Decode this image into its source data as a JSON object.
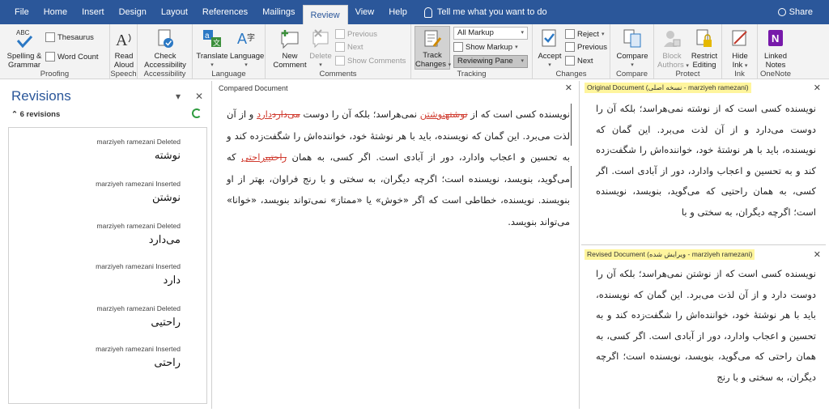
{
  "tabs": {
    "file": "File",
    "home": "Home",
    "insert": "Insert",
    "design": "Design",
    "layout": "Layout",
    "references": "References",
    "mailings": "Mailings",
    "review": "Review",
    "view": "View",
    "help": "Help",
    "tell_me": "Tell me what you want to do",
    "share": "Share"
  },
  "ribbon": {
    "proofing": {
      "label": "Proofing",
      "spelling_1": "Spelling &",
      "spelling_2": "Grammar",
      "thesaurus": "Thesaurus",
      "word_count": "Word Count"
    },
    "speech": {
      "label": "Speech",
      "read_1": "Read",
      "read_2": "Aloud"
    },
    "accessibility": {
      "label": "Accessibility",
      "check_1": "Check",
      "check_2": "Accessibility"
    },
    "language": {
      "label": "Language",
      "translate": "Translate",
      "language": "Language"
    },
    "comments": {
      "label": "Comments",
      "new_1": "New",
      "new_2": "Comment",
      "delete": "Delete",
      "previous": "Previous",
      "next": "Next",
      "show_comments": "Show Comments"
    },
    "tracking": {
      "label": "Tracking",
      "track_1": "Track",
      "track_2": "Changes",
      "all_markup": "All Markup",
      "show_markup": "Show Markup",
      "reviewing_pane": "Reviewing Pane"
    },
    "changes": {
      "label": "Changes",
      "accept": "Accept",
      "reject": "Reject",
      "previous": "Previous",
      "next": "Next"
    },
    "compare": {
      "label": "Compare",
      "compare": "Compare"
    },
    "protect": {
      "label": "Protect",
      "block_1": "Block",
      "block_2": "Authors",
      "restrict_1": "Restrict",
      "restrict_2": "Editing"
    },
    "ink": {
      "label": "Ink",
      "hide_1": "Hide",
      "hide_2": "Ink"
    },
    "onenote": {
      "label": "OneNote",
      "linked_1": "Linked",
      "linked_2": "Notes"
    }
  },
  "revisions": {
    "title": "Revisions",
    "count": "6 revisions",
    "items": [
      {
        "meta": "marziyeh ramezani Deleted",
        "word": "نوشته"
      },
      {
        "meta": "marziyeh ramezani Inserted",
        "word": "نوشتن"
      },
      {
        "meta": "marziyeh ramezani Deleted",
        "word": "می‌دارد"
      },
      {
        "meta": "marziyeh ramezani Inserted",
        "word": "دارد"
      },
      {
        "meta": "marziyeh ramezani Deleted",
        "word": "راحتیی"
      },
      {
        "meta": "marziyeh ramezani Inserted",
        "word": "راحتی"
      }
    ]
  },
  "compared": {
    "header": "Compared Document",
    "t1": "نویسنده کسی است که از ",
    "del1": "نوشته",
    "ins1": "نوشتن",
    "t2": " نمی‌هراسد؛ بلکه آن را دوست ",
    "del2": "می‌دارد",
    "ins2": "دارد",
    "t3": " و از آن لذت می‌برد. این گمان که نویسنده، باید با هر نوشتهٔ خود، خواننده‌اش را شگفت‌زده کند و به تحسین و اعجاب وادارد، دور از آبادی است. اگر کسی، به همان ",
    "del3": "راحتیی",
    "ins3": "راحتی",
    "t4": " که می‌گوید، بنویسد، نویسنده است؛ اگرچه دیگران، به سختی و با رنج فراوان، بهتر از او بنویسند. نویسنده، خطاطی است که اگر «خوش» یا «ممتاز» نمی‌تواند بنویسد، «خوانا» می‌تواند بنویسد."
  },
  "original": {
    "header": "Original Document (نسخه اصلی - marziyeh ramezani)",
    "text": "نویسنده کسی است که از نوشته نمی‌هراسد؛ بلکه آن را دوست می‌دارد و از آن لذت می‌برد. این گمان که نویسنده، باید با هر نوشتهٔ خود، خواننده‌اش را شگفت‌زده کند و به تحسین و اعجاب وادارد، دور از آبادی است. اگر کسی، به همان راحتیی که می‌گوید، بنویسد، نویسنده است؛ اگرچه دیگران، به سختی و با"
  },
  "revised": {
    "header": "Revised Document (ویرایش شده - marziyeh ramezani)",
    "text": "نویسنده کسی است که از نوشتن نمی‌هراسد؛ بلکه آن را دوست دارد و از آن لذت می‌برد. این گمان که نویسنده، باید با هر نوشتهٔ خود، خواننده‌اش را شگفت‌زده کند و به تحسین و اعجاب وادارد، دور از آبادی است. اگر کسی، به همان راحتی که می‌گوید، بنویسد، نویسنده است؛ اگرچه دیگران، به سختی و با رنج"
  }
}
